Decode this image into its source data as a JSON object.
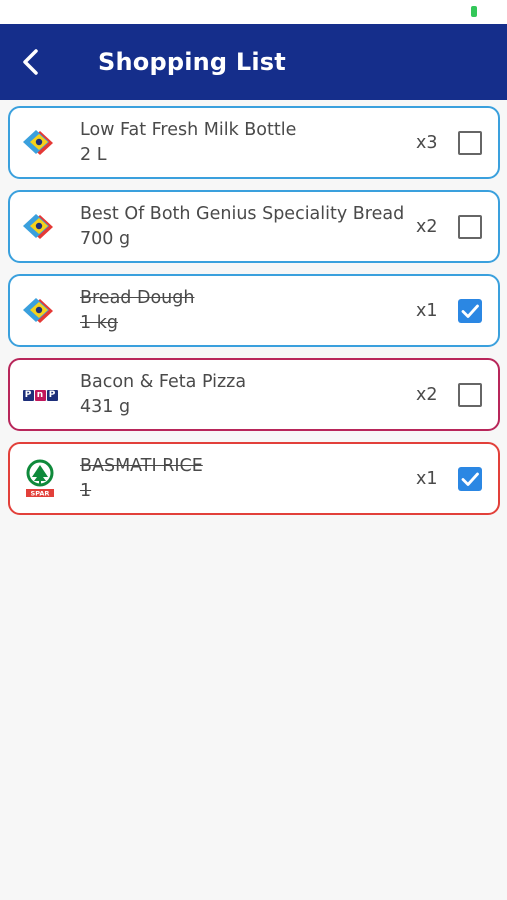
{
  "header": {
    "title": "Shopping List"
  },
  "colors": {
    "app_bar": "#152e8b",
    "checkbox_checked": "#2b87e3",
    "store_border_checkers": "#3aa0dd",
    "store_border_pnp": "#b8265a",
    "store_border_spar": "#e2403a"
  },
  "items": [
    {
      "store": "checkers",
      "name": "Low Fat Fresh Milk Bottle",
      "size": "2 L",
      "qty": "x3",
      "checked": false
    },
    {
      "store": "checkers",
      "name": "Best Of Both Genius Speciality Bread",
      "size": "700 g",
      "qty": "x2",
      "checked": false
    },
    {
      "store": "checkers",
      "name": "Bread Dough",
      "size": "1 kg",
      "qty": "x1",
      "checked": true
    },
    {
      "store": "pnp",
      "name": "Bacon & Feta Pizza",
      "size": "431 g",
      "qty": "x2",
      "checked": false
    },
    {
      "store": "spar",
      "name": "BASMATI RICE",
      "size": "1",
      "qty": "x1",
      "checked": true
    }
  ],
  "logos": {
    "pnp": {
      "icon": "pnp-logo",
      "letters": [
        "P",
        "n",
        "P"
      ]
    },
    "spar": {
      "icon": "spar-logo",
      "text": "SPAR"
    },
    "checkers": {
      "icon": "checkers-logo"
    }
  }
}
